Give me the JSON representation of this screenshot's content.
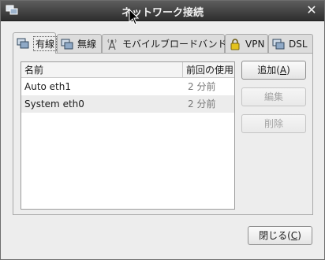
{
  "window": {
    "title": "ネットワーク接続",
    "close_symbol": "✕"
  },
  "tabs": [
    {
      "label": "有線",
      "icon": "wired-network-icon",
      "active": true
    },
    {
      "label": "無線",
      "icon": "wireless-network-icon",
      "active": false
    },
    {
      "label": "モバイルブロードバンド",
      "icon": "antenna-icon",
      "active": false
    },
    {
      "label": "VPN",
      "icon": "lock-icon",
      "active": false
    },
    {
      "label": "DSL",
      "icon": "dsl-network-icon",
      "active": false
    }
  ],
  "list": {
    "headers": {
      "name": "名前",
      "last_used": "前回の使用"
    },
    "rows": [
      {
        "name": "Auto eth1",
        "last_used": "2 分前"
      },
      {
        "name": "System eth0",
        "last_used": "2 分前"
      }
    ]
  },
  "buttons": {
    "add": {
      "label": "追加(",
      "mnemonic": "A",
      "suffix": ")"
    },
    "edit": "編集",
    "delete": "削除",
    "close": {
      "label": "閉じる(",
      "mnemonic": "C",
      "suffix": ")"
    }
  }
}
